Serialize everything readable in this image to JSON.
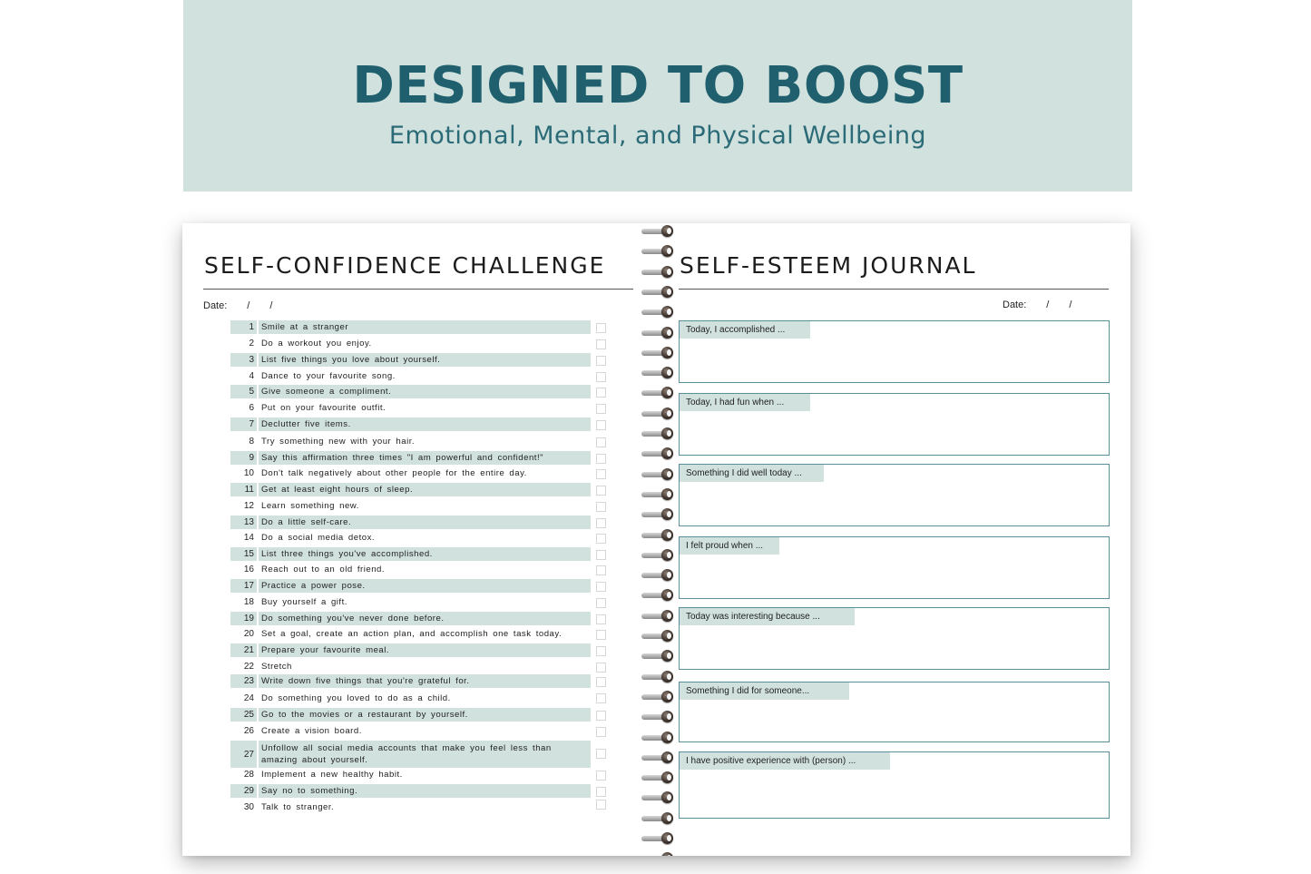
{
  "banner": {
    "title": "DESIGNED TO BOOST",
    "subtitle": "Emotional, Mental, and Physical Wellbeing"
  },
  "left_page": {
    "title": "SELF-CONFIDENCE CHALLENGE",
    "date_label": "Date:",
    "date_slash": "/",
    "items": [
      {
        "num": "1",
        "text": "Smile at a stranger"
      },
      {
        "num": "2",
        "text": "Do a workout you enjoy."
      },
      {
        "num": "3",
        "text": "List five things you love about yourself."
      },
      {
        "num": "4",
        "text": "Dance to your favourite song."
      },
      {
        "num": "5",
        "text": "Give someone a compliment."
      },
      {
        "num": "6",
        "text": "Put on your favourite outfit."
      },
      {
        "num": "7",
        "text": "Declutter five items."
      },
      {
        "num": "8",
        "text": "Try something new with your hair."
      },
      {
        "num": "9",
        "text": "Say this affirmation three times \"I am powerful and confident!\""
      },
      {
        "num": "10",
        "text": "Don't talk negatively about other people for the entire day."
      },
      {
        "num": "11",
        "text": "Get at least eight hours of sleep."
      },
      {
        "num": "12",
        "text": "Learn something new."
      },
      {
        "num": "13",
        "text": "Do a little self-care."
      },
      {
        "num": "14",
        "text": "Do a social media detox."
      },
      {
        "num": "15",
        "text": "List three things you've accomplished."
      },
      {
        "num": "16",
        "text": "Reach out to an old friend."
      },
      {
        "num": "17",
        "text": "Practice a power pose."
      },
      {
        "num": "18",
        "text": "Buy yourself a gift."
      },
      {
        "num": "19",
        "text": "Do something you've never done before."
      },
      {
        "num": "20",
        "text": "Set a goal, create an action plan, and accomplish one task today."
      },
      {
        "num": "21",
        "text": "Prepare your favourite meal."
      },
      {
        "num": "22",
        "text": "Stretch"
      },
      {
        "num": "23",
        "text": "Write down five things that you're grateful for."
      },
      {
        "num": "24",
        "text": "Do something you loved to do as a child."
      },
      {
        "num": "25",
        "text": "Go to the movies or a restaurant by yourself."
      },
      {
        "num": "26",
        "text": "Create a vision board."
      },
      {
        "num": "27",
        "text": "Unfollow all social media accounts that make you feel less than amazing about yourself."
      },
      {
        "num": "28",
        "text": "Implement a new healthy habit."
      },
      {
        "num": "29",
        "text": "Say no to something."
      },
      {
        "num": "30",
        "text": "Talk to stranger."
      }
    ]
  },
  "right_page": {
    "title": "SELF-ESTEEM JOURNAL",
    "date_label": "Date:",
    "date_slash": "/",
    "prompts": [
      "Today, I accomplished ...",
      "Today, I had fun when ...",
      "Something I did well today ...",
      "I felt proud when ...",
      "Today was interesting because ...",
      "Something I did for someone...",
      "I have positive experience with (person) ..."
    ]
  },
  "colors": {
    "banner_bg": "#d1e2de",
    "title_text": "#20606e",
    "row_shade": "#d1e2de",
    "box_border": "#5b8f9c"
  }
}
